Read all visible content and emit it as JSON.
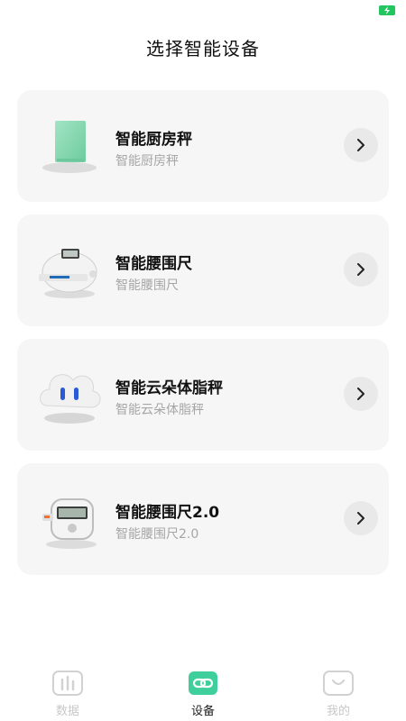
{
  "header": {
    "title": "选择智能设备"
  },
  "devices": [
    {
      "name": "智能厨房秤",
      "subtitle": "智能厨房秤",
      "icon": "kitchen-scale-icon"
    },
    {
      "name": "智能腰围尺",
      "subtitle": "智能腰围尺",
      "icon": "waist-tape-icon"
    },
    {
      "name": "智能云朵体脂秤",
      "subtitle": "智能云朵体脂秤",
      "icon": "cloud-scale-icon"
    },
    {
      "name": "智能腰围尺2.0",
      "subtitle": "智能腰围尺2.0",
      "icon": "waist-tape-v2-icon"
    }
  ],
  "tabs": [
    {
      "label": "数据",
      "icon": "bar-chart-icon",
      "active": false
    },
    {
      "label": "设备",
      "icon": "link-icon",
      "active": true
    },
    {
      "label": "我的",
      "icon": "smile-face-icon",
      "active": false
    }
  ],
  "colors": {
    "accent": "#3ecf9c",
    "battery": "#22c55e",
    "card_bg": "#f6f6f6",
    "muted_text": "#a6a6a6"
  }
}
